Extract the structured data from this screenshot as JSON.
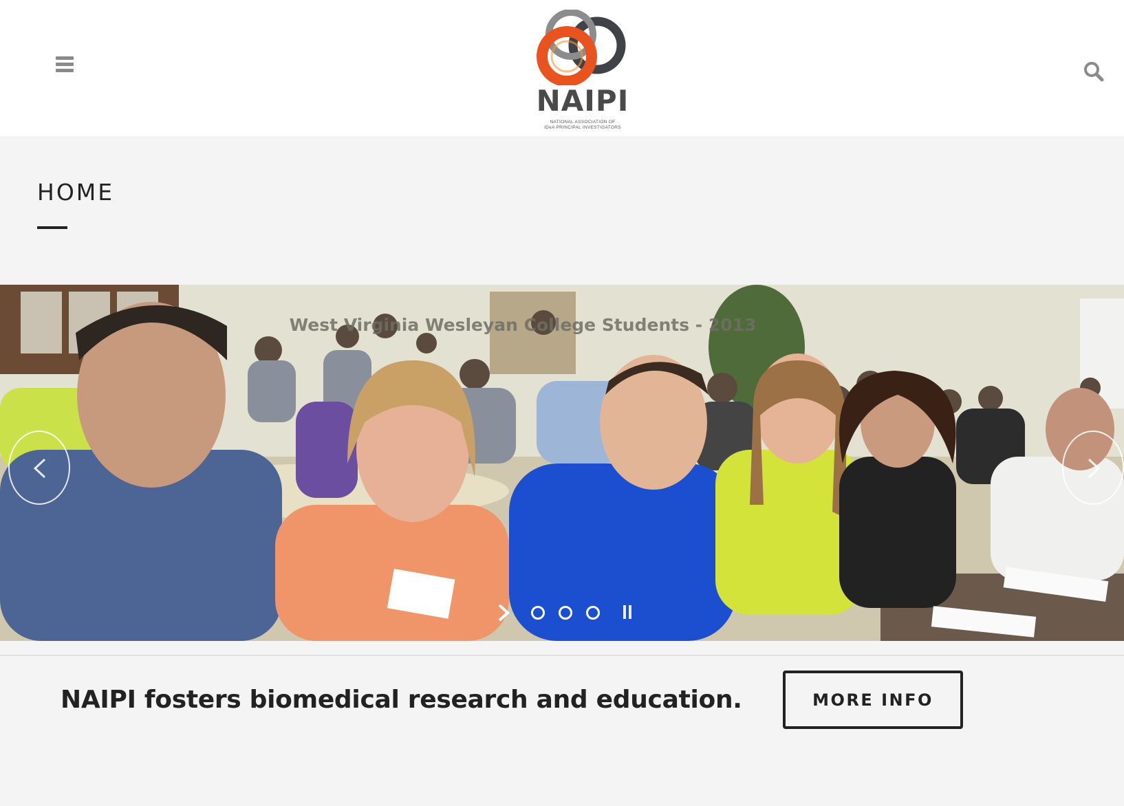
{
  "header": {
    "menu_icon": "hamburger-menu-icon",
    "search_icon": "search-icon",
    "logo": {
      "name": "NAIPI",
      "subtitle_line1": "NATIONAL ASSOCIATION OF",
      "subtitle_line2": "IDeA PRINCIPAL INVESTIGATORS",
      "colors": {
        "orange": "#e8531f",
        "gray": "#6b6b6b",
        "dark": "#4a4a4a"
      }
    }
  },
  "page": {
    "title": "HOME"
  },
  "slider": {
    "caption": "West Virginia Wesleyan College Students - 2013",
    "prev_icon": "chevron-left-icon",
    "next_icon": "chevron-right-icon",
    "slide_count": 3,
    "pause_icon": "pause-icon"
  },
  "cta": {
    "text": "NAIPI fosters biomedical research and education.",
    "button_label": "MORE INFO"
  }
}
